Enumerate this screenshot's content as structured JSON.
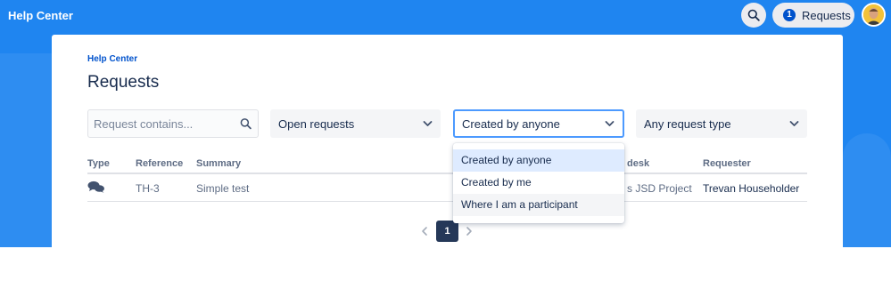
{
  "header": {
    "brand": "Help Center",
    "search_icon": "search-icon",
    "requests_count": "1",
    "requests_label": "Requests",
    "avatar_icon": "user-avatar"
  },
  "card": {
    "breadcrumb": "Help Center",
    "title": "Requests"
  },
  "filters": {
    "search_placeholder": "Request contains...",
    "status_select": "Open requests",
    "created_by_select": "Created by anyone",
    "type_select": "Any request type"
  },
  "table": {
    "columns": [
      "Type",
      "Reference",
      "Summary",
      "desk",
      "Requester"
    ],
    "rows": [
      {
        "type_icon": "speech-bubbles-icon",
        "reference": "TH-3",
        "summary": "Simple test",
        "service_desk": "s JSD Project",
        "requester": "Trevan Householder"
      }
    ]
  },
  "pagination": {
    "current_page": "1"
  },
  "dropdown": {
    "options": [
      "Created by anyone",
      "Created by me",
      "Where I am a participant"
    ],
    "selected": "Created by anyone"
  },
  "colors": {
    "header_bg": "#1f85f0",
    "accent": "#0052cc",
    "selected_option": "#deebff",
    "focus_border": "#4c9aff"
  }
}
